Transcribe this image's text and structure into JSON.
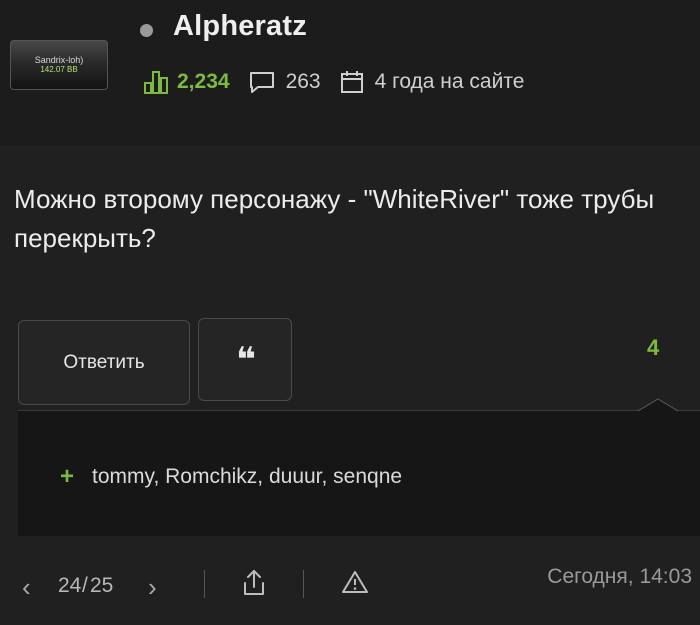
{
  "author": {
    "name": "Alpheratz",
    "avatar_text_top": "Sandrix-loh)",
    "avatar_text_bottom": "142.07 BB",
    "rating": "2,234",
    "comments_count": "263",
    "membership": "4 года на сайте"
  },
  "comment": {
    "text": "Можно второму персонажу - \"WhiteRiver\" тоже трубы перекрыть?"
  },
  "actions": {
    "reply_label": "Ответить",
    "quote_label": "❝",
    "votes": "4"
  },
  "voters": {
    "plus": "+",
    "names": "tommy, Romchikz, duuur, senqne"
  },
  "footer": {
    "page_current": "24",
    "page_separator": "/",
    "page_total": "25",
    "timestamp": "Сегодня, 14:03"
  },
  "colors": {
    "background": "#202020",
    "accent_green": "#7cbb3d",
    "muted_text": "#9a9a9a"
  },
  "icons": [
    "rating-icon",
    "comment-icon",
    "calendar-icon",
    "chevron-left-icon",
    "chevron-right-icon",
    "share-icon",
    "warning-icon"
  ]
}
